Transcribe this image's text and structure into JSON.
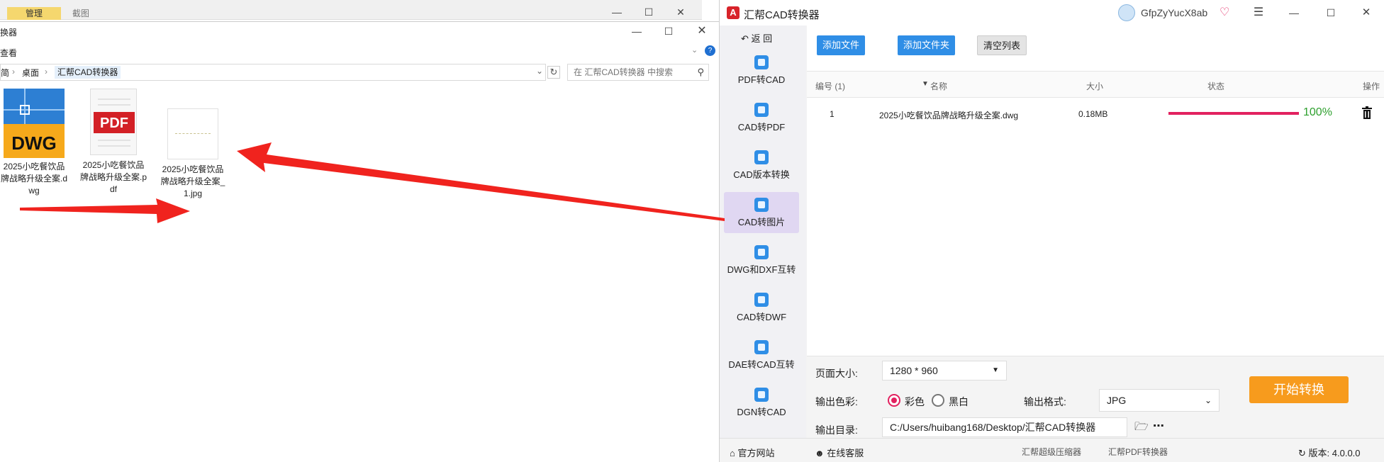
{
  "explorer": {
    "bg_window": {
      "tab_active": "管理",
      "tab_inactive": "截图"
    },
    "title": "换器",
    "menu": "查看",
    "breadcrumb": {
      "part1": "简",
      "part2": "桌面",
      "current": "汇帮CAD转换器"
    },
    "search_placeholder": "在 汇帮CAD转换器 中搜索",
    "files": [
      {
        "name": "2025小吃餐饮品牌战略升级全案.dwg",
        "icon": "dwg-file-icon",
        "badge": "DWG"
      },
      {
        "name": "2025小吃餐饮品牌战略升级全案.pdf",
        "icon": "pdf-file-icon",
        "badge": "PDF"
      },
      {
        "name": "2025小吃餐饮品牌战略升级全案_1.jpg",
        "icon": "jpg-file-icon"
      }
    ]
  },
  "app": {
    "title": "汇帮CAD转换器",
    "user": "GfpZyYucX8ab",
    "back": "返 回",
    "sidebar": [
      {
        "label": "PDF转CAD"
      },
      {
        "label": "CAD转PDF"
      },
      {
        "label": "CAD版本转换"
      },
      {
        "label": "CAD转图片",
        "active": true
      },
      {
        "label": "DWG和DXF互转"
      },
      {
        "label": "CAD转DWF"
      },
      {
        "label": "DAE转CAD互转"
      },
      {
        "label": "DGN转CAD"
      }
    ],
    "toolbar": {
      "add_file": "添加文件",
      "add_folder": "添加文件夹",
      "clear_list": "清空列表"
    },
    "table": {
      "headers": {
        "index": "编号 (1)",
        "name": "名称",
        "size": "大小",
        "status": "状态",
        "action": "操作"
      },
      "rows": [
        {
          "index": "1",
          "name": "2025小吃餐饮品牌战略升级全案.dwg",
          "size": "0.18MB",
          "progress": 1.0,
          "progress_text": "100%"
        }
      ]
    },
    "settings": {
      "page_size_label": "页面大小:",
      "page_size_value": "1280 * 960",
      "color_label": "输出色彩:",
      "color_option_color": "彩色",
      "color_option_bw": "黑白",
      "format_label": "输出格式:",
      "format_value": "JPG",
      "output_dir_label": "输出目录:",
      "output_dir_value": "C:/Users/huibang168/Desktop/汇帮CAD转换器",
      "start_button": "开始转换"
    },
    "footer": {
      "website": "官方网站",
      "support": "在线客服",
      "link1": "汇帮超级压缩器",
      "link2": "汇帮PDF转换器",
      "version_label": "版本:",
      "version_value": "4.0.0.0"
    },
    "colors": {
      "accent_blue": "#2f8ee6",
      "progress_pink": "#e2215f",
      "start_orange": "#f79b1d",
      "status_green": "#2ea02e"
    }
  }
}
